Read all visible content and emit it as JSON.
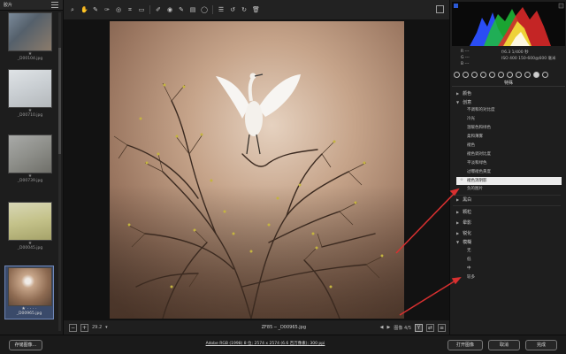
{
  "filmstrip": {
    "title": "胶片",
    "items": [
      {
        "name": "_D00104.jpg",
        "stars": "★"
      },
      {
        "name": "_D00710.jpg",
        "stars": "★"
      },
      {
        "name": "_D00739.jpg",
        "stars": "★"
      },
      {
        "name": "_D00045.jpg",
        "stars": "★"
      },
      {
        "name": "_D00965.jpg",
        "stars": "★ · · · ·"
      }
    ]
  },
  "canvas_status": {
    "zoom": "29.2",
    "filename": "ZF85 ─ _D00965.jpg",
    "image_counter": "图像 4/5"
  },
  "histogram": {
    "row1_left": "R  ---",
    "row1_right": "f/6.3  1/400 秒",
    "row2_left": "G  ---",
    "row2_right": "ISO 400  150-600@600 毫米",
    "row3_left": "B  ---"
  },
  "panel": {
    "title": "特殊",
    "sections": {
      "color": "颜色",
      "creative": "创意",
      "creative_items": [
        "不调和的对比度",
        "冷光",
        "温暖色和绿色",
        "柔和薄雾",
        "褪色",
        "褪色调对比度",
        "平淡和绿色",
        "过曝褪色黄度"
      ],
      "selected_item": "褪色消阴影",
      "after_selected": "负的图片",
      "bw": "黑白",
      "grain": "颗粒",
      "vignette": "晕影",
      "sharpen": "锐化",
      "blur": "模糊",
      "blur_items": [
        "无",
        "低",
        "中",
        "较多"
      ]
    }
  },
  "bottom": {
    "save_label": "存储图像...",
    "export_info": "Adobe RGB (1998) 8 位; 2574 x 2574 (6.6 百万像素); 300 ppi",
    "open_label": "打开图像",
    "cancel_label": "取消",
    "done_label": "完成"
  },
  "colors": {
    "accent": "#6f87b7",
    "selected_row_bg": "#ececec",
    "annotation_red": "#d93030"
  }
}
